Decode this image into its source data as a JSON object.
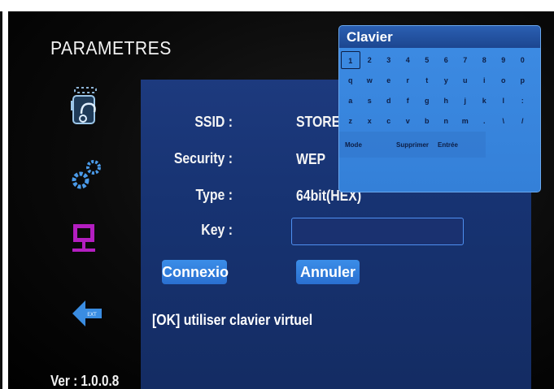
{
  "screen": {
    "title": "PARAMETRES",
    "version": "Ver : 1.0.0.8"
  },
  "sidebar": {
    "icons": [
      {
        "name": "remote-control-icon"
      },
      {
        "name": "settings-gears-icon"
      },
      {
        "name": "network-monitor-icon",
        "color": "#b31ec0"
      },
      {
        "name": "exit-back-icon",
        "label": "EXIT"
      }
    ]
  },
  "form": {
    "fields": [
      {
        "label": "SSID :",
        "value": "STORE"
      },
      {
        "label": "Security :",
        "value": "WEP"
      },
      {
        "label": "Type :",
        "value": "64bit(HEX)"
      },
      {
        "label": "Key :",
        "value": ""
      }
    ],
    "connect_label": "Connexio",
    "cancel_label": "Annuler",
    "hint": "[OK] utiliser clavier virtuel"
  },
  "keyboard": {
    "title": "Clavier",
    "rows": [
      [
        "1",
        "2",
        "3",
        "4",
        "5",
        "6",
        "7",
        "8",
        "9",
        "0"
      ],
      [
        "q",
        "w",
        "e",
        "r",
        "t",
        "y",
        "u",
        "i",
        "o",
        "p"
      ],
      [
        "a",
        "s",
        "d",
        "f",
        "g",
        "h",
        "j",
        "k",
        "l",
        ":"
      ],
      [
        "z",
        "x",
        "c",
        "v",
        "b",
        "n",
        "m",
        ".",
        "\\",
        "/"
      ]
    ],
    "selected_key": "1",
    "actions": [
      "Mode",
      "Supprimer",
      "Entrée"
    ]
  },
  "colors": {
    "panel": "#173372",
    "button": "#2f7ddc",
    "keyboard": "#3a86de"
  }
}
